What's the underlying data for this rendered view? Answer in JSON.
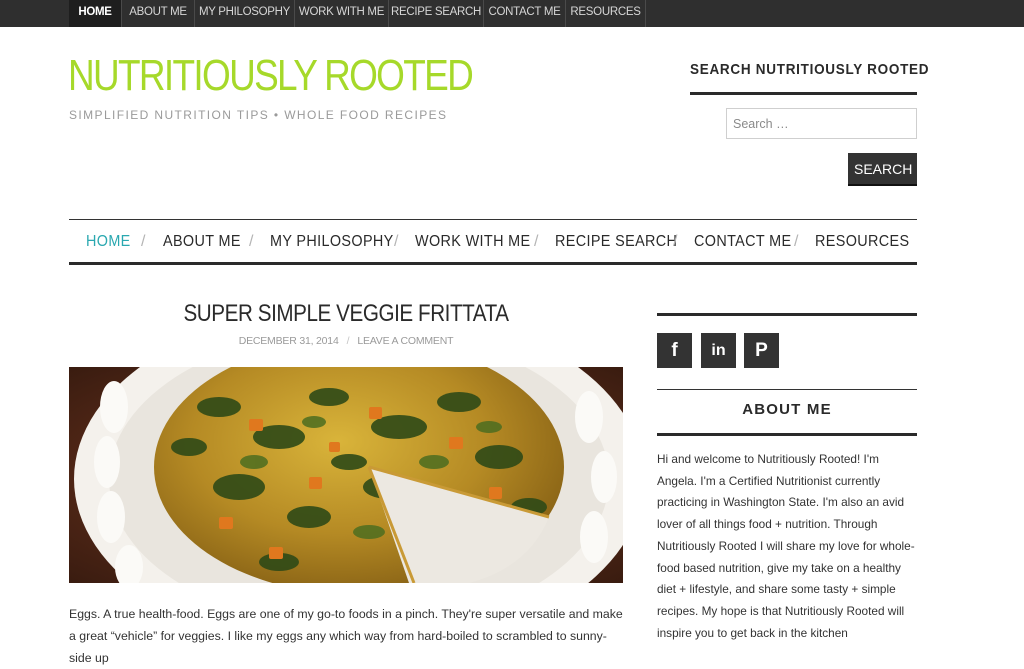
{
  "topbar": {
    "items": [
      {
        "label": "HOME"
      },
      {
        "label": "ABOUT ME"
      },
      {
        "label": "MY PHILOSOPHY"
      },
      {
        "label": "WORK WITH ME"
      },
      {
        "label": "RECIPE SEARCH"
      },
      {
        "label": "CONTACT ME"
      },
      {
        "label": "RESOURCES"
      }
    ]
  },
  "header": {
    "site_title": "NUTRITIOUSLY ROOTED",
    "tagline": "SIMPLIFIED NUTRITION TIPS • WHOLE FOOD RECIPES"
  },
  "search": {
    "widget_title": "SEARCH NUTRITIOUSLY ROOTED",
    "placeholder": "Search …",
    "button_label": "SEARCH"
  },
  "mainnav": {
    "items": [
      {
        "label": "HOME"
      },
      {
        "label": "ABOUT ME"
      },
      {
        "label": "MY PHILOSOPHY"
      },
      {
        "label": "WORK WITH ME"
      },
      {
        "label": "RECIPE SEARCH"
      },
      {
        "label": "CONTACT ME"
      },
      {
        "label": "RESOURCES"
      }
    ],
    "separator": "/"
  },
  "post": {
    "title": "SUPER SIMPLE VEGGIE FRITTATA",
    "date": "DECEMBER 31, 2014",
    "meta_separator": "/",
    "comment_link": "LEAVE A COMMENT",
    "body": "Eggs. A true health-food. Eggs are one of my go-to foods in a pinch. They're super versatile and make a great “vehicle” for veggies. I like my eggs any which way from hard-boiled to scrambled to sunny-side up"
  },
  "sidebar": {
    "social": [
      {
        "glyph": "f",
        "icon": "facebook-icon"
      },
      {
        "glyph": "in",
        "icon": "linkedin-icon"
      },
      {
        "glyph": "P",
        "icon": "pinterest-icon"
      }
    ],
    "about_title": "ABOUT ME",
    "about_text": "Hi and welcome to Nutritiously Rooted! I'm Angela. I'm a Certified Nutritionist currently practicing in Washington State. I'm also an avid lover of all things food + nutrition. Through Nutritiously Rooted I will share my love for whole-food based nutrition, give my take on a healthy diet + lifestyle, and share some tasty + simple recipes. My hope is that Nutritiously Rooted will inspire you to get back in the kitchen"
  },
  "colors": {
    "brand_green": "#a6d92a",
    "accent_teal": "#2aa8b0",
    "topbar_bg": "#2f2f2f"
  }
}
